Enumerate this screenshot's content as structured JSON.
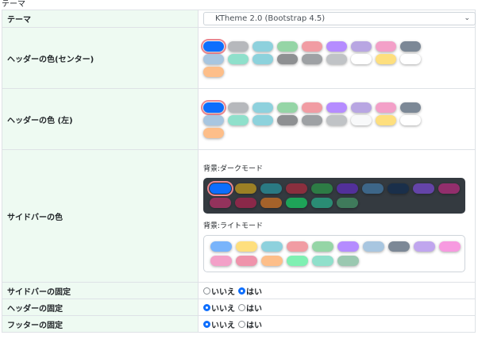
{
  "caption": "テーマ",
  "theme": {
    "label": "テーマ",
    "selected": "KTheme 2.0 (Bootstrap 4.5)"
  },
  "header_center": {
    "label": "ヘッダーの色(センター)",
    "colors": [
      "#0d6efd",
      "#b6b8bc",
      "#8ed1dd",
      "#95d5a6",
      "#f19ca3",
      "#b58cff",
      "#b8a6e2",
      "#f3a0c8",
      "#7c8896",
      "#a8c6e0",
      "#8fe0cb",
      "#8dd2dc",
      "#8e9092",
      "#9ea1a4",
      "#c0c3c6",
      "#ffffff",
      "#fedf7e",
      "#ffffff",
      "#fdbe89"
    ],
    "selected_index": 0
  },
  "header_left": {
    "label": "ヘッダーの色 (左)",
    "colors": [
      "#0d6efd",
      "#b6b8bc",
      "#8ed1dd",
      "#95d5a6",
      "#f19ca3",
      "#b58cff",
      "#b8a6e2",
      "#f3a0c8",
      "#7c8896",
      "#a8c6e0",
      "#8fe0cb",
      "#8dd2dc",
      "#8e9092",
      "#9ea1a4",
      "#c0c3c6",
      "#f8f9fa",
      "#fedf7e",
      "#ffffff",
      "#fdbe89"
    ],
    "selected_index": 0
  },
  "sidebar_color": {
    "label": "サイドバーの色",
    "dark_label": "背景:ダークモード",
    "dark_colors": [
      "#0d6efd",
      "#9c8025",
      "#2a7a83",
      "#8a2f3e",
      "#2d7c45",
      "#52309a",
      "#3d6688",
      "#1a2f4a",
      "#6444a8",
      "#922e6c",
      "#93325c",
      "#8a2849",
      "#a5622a",
      "#1ea358",
      "#2a8c74",
      "#3f7a5b"
    ],
    "dark_selected_index": 0,
    "light_label": "背景:ライトモード",
    "light_colors": [
      "#79b4fb",
      "#fedf7e",
      "#8ed1dd",
      "#f19ca3",
      "#95d5a6",
      "#b58cff",
      "#a8c6e0",
      "#7c8896",
      "#c0a6ee",
      "#f79ae0",
      "#f3a0c8",
      "#ef93ab",
      "#fdbe89",
      "#7ff0b2",
      "#8fe0cb",
      "#9ac8b0"
    ]
  },
  "sidebar_fixed": {
    "label": "サイドバーの固定",
    "options": [
      "いいえ",
      "はい"
    ],
    "selected": 1
  },
  "header_fixed": {
    "label": "ヘッダーの固定",
    "options": [
      "いいえ",
      "はい"
    ],
    "selected": 0
  },
  "footer_fixed": {
    "label": "フッターの固定",
    "options": [
      "いいえ",
      "はい"
    ],
    "selected": 0
  }
}
